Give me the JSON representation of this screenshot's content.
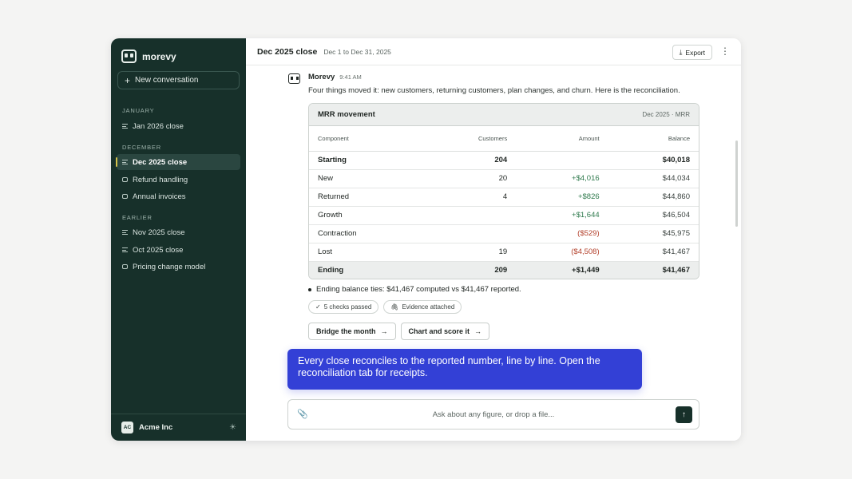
{
  "sidebar": {
    "brand": "morevy",
    "new_conversation": "New conversation",
    "sections": [
      {
        "label": "JANUARY",
        "items": [
          {
            "label": "Jan 2026 close",
            "icon": "lines-icon"
          }
        ]
      },
      {
        "label": "DECEMBER",
        "items": [
          {
            "label": "Dec 2025 close",
            "icon": "lines-icon",
            "active": true
          },
          {
            "label": "Refund handling",
            "icon": "chat-icon"
          },
          {
            "label": "Annual invoices",
            "icon": "chat-icon"
          }
        ]
      },
      {
        "label": "EARLIER",
        "items": [
          {
            "label": "Nov 2025 close",
            "icon": "lines-icon"
          },
          {
            "label": "Oct 2025 close",
            "icon": "lines-icon"
          },
          {
            "label": "Pricing change model",
            "icon": "chat-icon"
          }
        ]
      }
    ],
    "footer": {
      "avatar": "AC",
      "org": "Acme Inc"
    }
  },
  "header": {
    "title": "Dec 2025 close",
    "range": "Dec 1 to Dec 31, 2025",
    "export_label": "Export",
    "more_glyph": "⋮"
  },
  "message": {
    "author": "Morevy",
    "time": "9:41 AM",
    "body": "Four things moved it: new customers, returning customers, plan changes, and churn. Here is the reconciliation."
  },
  "table": {
    "title": "MRR movement",
    "subtitle": "Dec 2025 · MRR",
    "columns": [
      "Component",
      "Customers",
      "Amount",
      "Balance"
    ],
    "rows": [
      {
        "component": "Starting",
        "customers": "204",
        "amount": "",
        "balance": "$40,018"
      },
      {
        "component": "New",
        "customers": "20",
        "amount": "+$4,016",
        "balance": "$44,034"
      },
      {
        "component": "Returned",
        "customers": "4",
        "amount": "+$826",
        "balance": "$44,860"
      },
      {
        "component": "Growth",
        "customers": "",
        "amount": "+$1,644",
        "balance": "$46,504"
      },
      {
        "component": "Contraction",
        "customers": "",
        "amount": "($529)",
        "balance": "$45,975"
      },
      {
        "component": "Lost",
        "customers": "19",
        "amount": "($4,508)",
        "balance": "$41,467"
      },
      {
        "component": "Ending",
        "customers": "209",
        "amount": "+$1,449",
        "balance": "$41,467"
      }
    ]
  },
  "summary": {
    "bullet": "Ending balance ties: $41,467 computed vs $41,467 reported.",
    "chips": [
      "5 checks passed",
      "Evidence attached"
    ]
  },
  "actions": {
    "bridge": "Bridge the month",
    "chart": "Chart and score it"
  },
  "callout": {
    "text": "Every close reconciles to the reported number, line by line. Open the reconciliation tab for receipts."
  },
  "composer": {
    "placeholder": "Ask about any figure, or drop a file..."
  },
  "colors": {
    "sidebar_bg": "#17302a",
    "accent_blue": "#3340d6",
    "positive": "#2f7a4d",
    "negative": "#b3402b"
  }
}
